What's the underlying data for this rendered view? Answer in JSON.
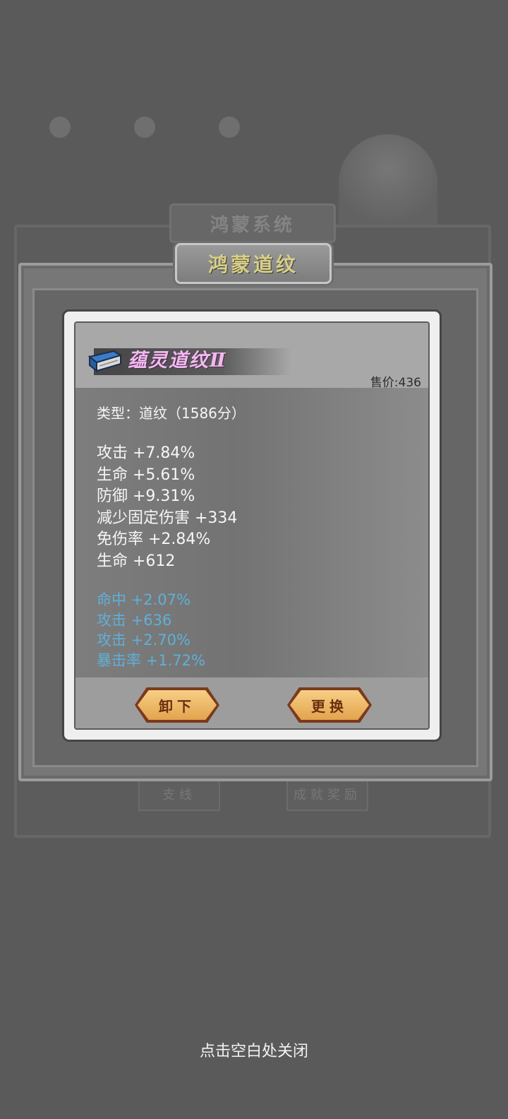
{
  "background": {
    "system_title": "鸿蒙系统",
    "bottom_buttons": [
      "支线",
      "成就奖励"
    ]
  },
  "panel": {
    "title": "鸿蒙道纹"
  },
  "item": {
    "icon": "book-icon",
    "name": "蕴灵道纹Ⅱ",
    "name_color": "#f2b8ef",
    "price": "售价:436",
    "type_line": "类型：道纹（1586分）",
    "base_stats": [
      "攻击 +7.84%",
      "生命 +5.61%",
      "防御 +9.31%",
      "减少固定伤害 +334",
      "免伤率 +2.84%",
      "生命 +612"
    ],
    "extra_stats": [
      "命中 +2.07%",
      "攻击 +636",
      "攻击 +2.70%",
      "暴击率 +1.72%"
    ],
    "extra_stat_color": "#5fb0d8"
  },
  "buttons": {
    "unequip": "卸下",
    "replace": "更换"
  },
  "close_hint": "点击空白处关闭"
}
